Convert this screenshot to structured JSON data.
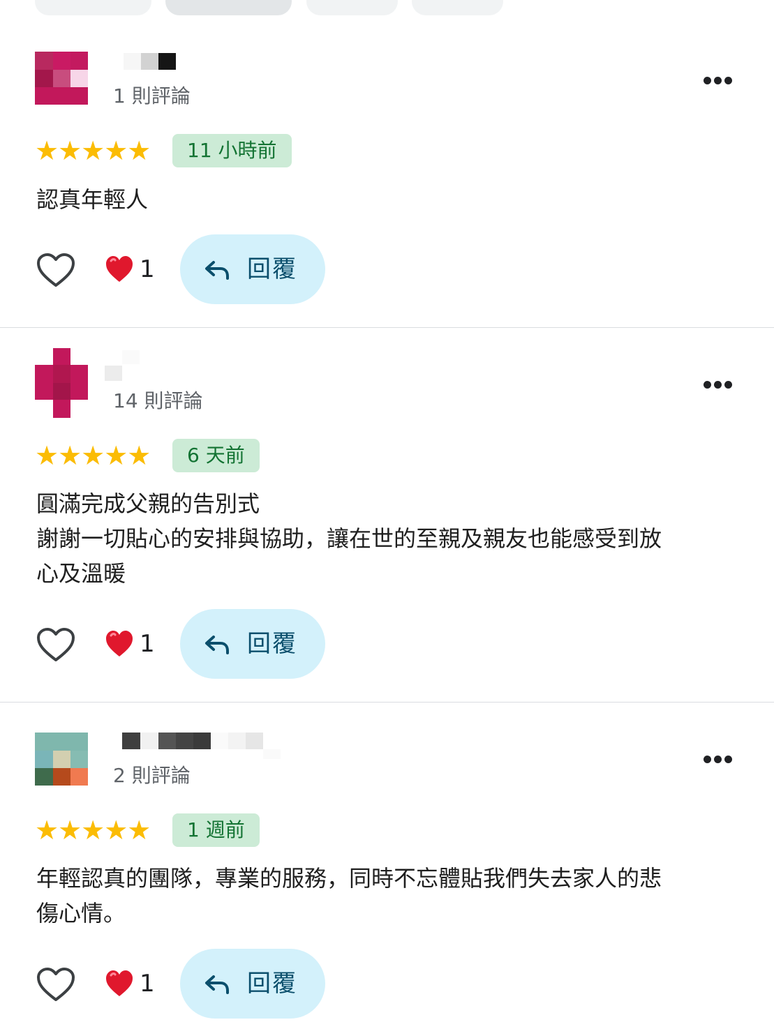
{
  "filter_chips": [
    {
      "selected": false
    },
    {
      "selected": true
    },
    {
      "selected": false
    },
    {
      "selected": false
    }
  ],
  "reviews": [
    {
      "review_count": "1 則評論",
      "rating": 5,
      "stars": "★★★★★",
      "time": "11 小時前",
      "text": "認真年輕人",
      "reaction_count": "1",
      "reply_label": "回覆"
    },
    {
      "review_count": "14 則評論",
      "rating": 5,
      "stars": "★★★★★",
      "time": "6 天前",
      "text": "圓滿完成父親的告別式\n謝謝一切貼心的安排與協助，讓在世的至親及親友也能感受到放\n心及溫暖",
      "reaction_count": "1",
      "reply_label": "回覆"
    },
    {
      "review_count": "2 則評論",
      "rating": 5,
      "stars": "★★★★★",
      "time": "1 週前",
      "text": "年輕認真的團隊，專業的服務，同時不忘體貼我們失去家人的悲\n傷心情。",
      "reaction_count": "1",
      "reply_label": "回覆"
    }
  ],
  "colors": {
    "star": "#fbbc04",
    "time_badge_bg": "#ccebd6",
    "time_badge_text": "#137333",
    "reply_bg": "#d3f1fb",
    "reply_text": "#0b4f6c",
    "reaction_heart": "#e0182d"
  },
  "icons": {
    "like": "heart-outline-icon",
    "reaction": "red-heart-icon",
    "reply": "reply-arrow-icon",
    "more": "more-horizontal-icon"
  }
}
